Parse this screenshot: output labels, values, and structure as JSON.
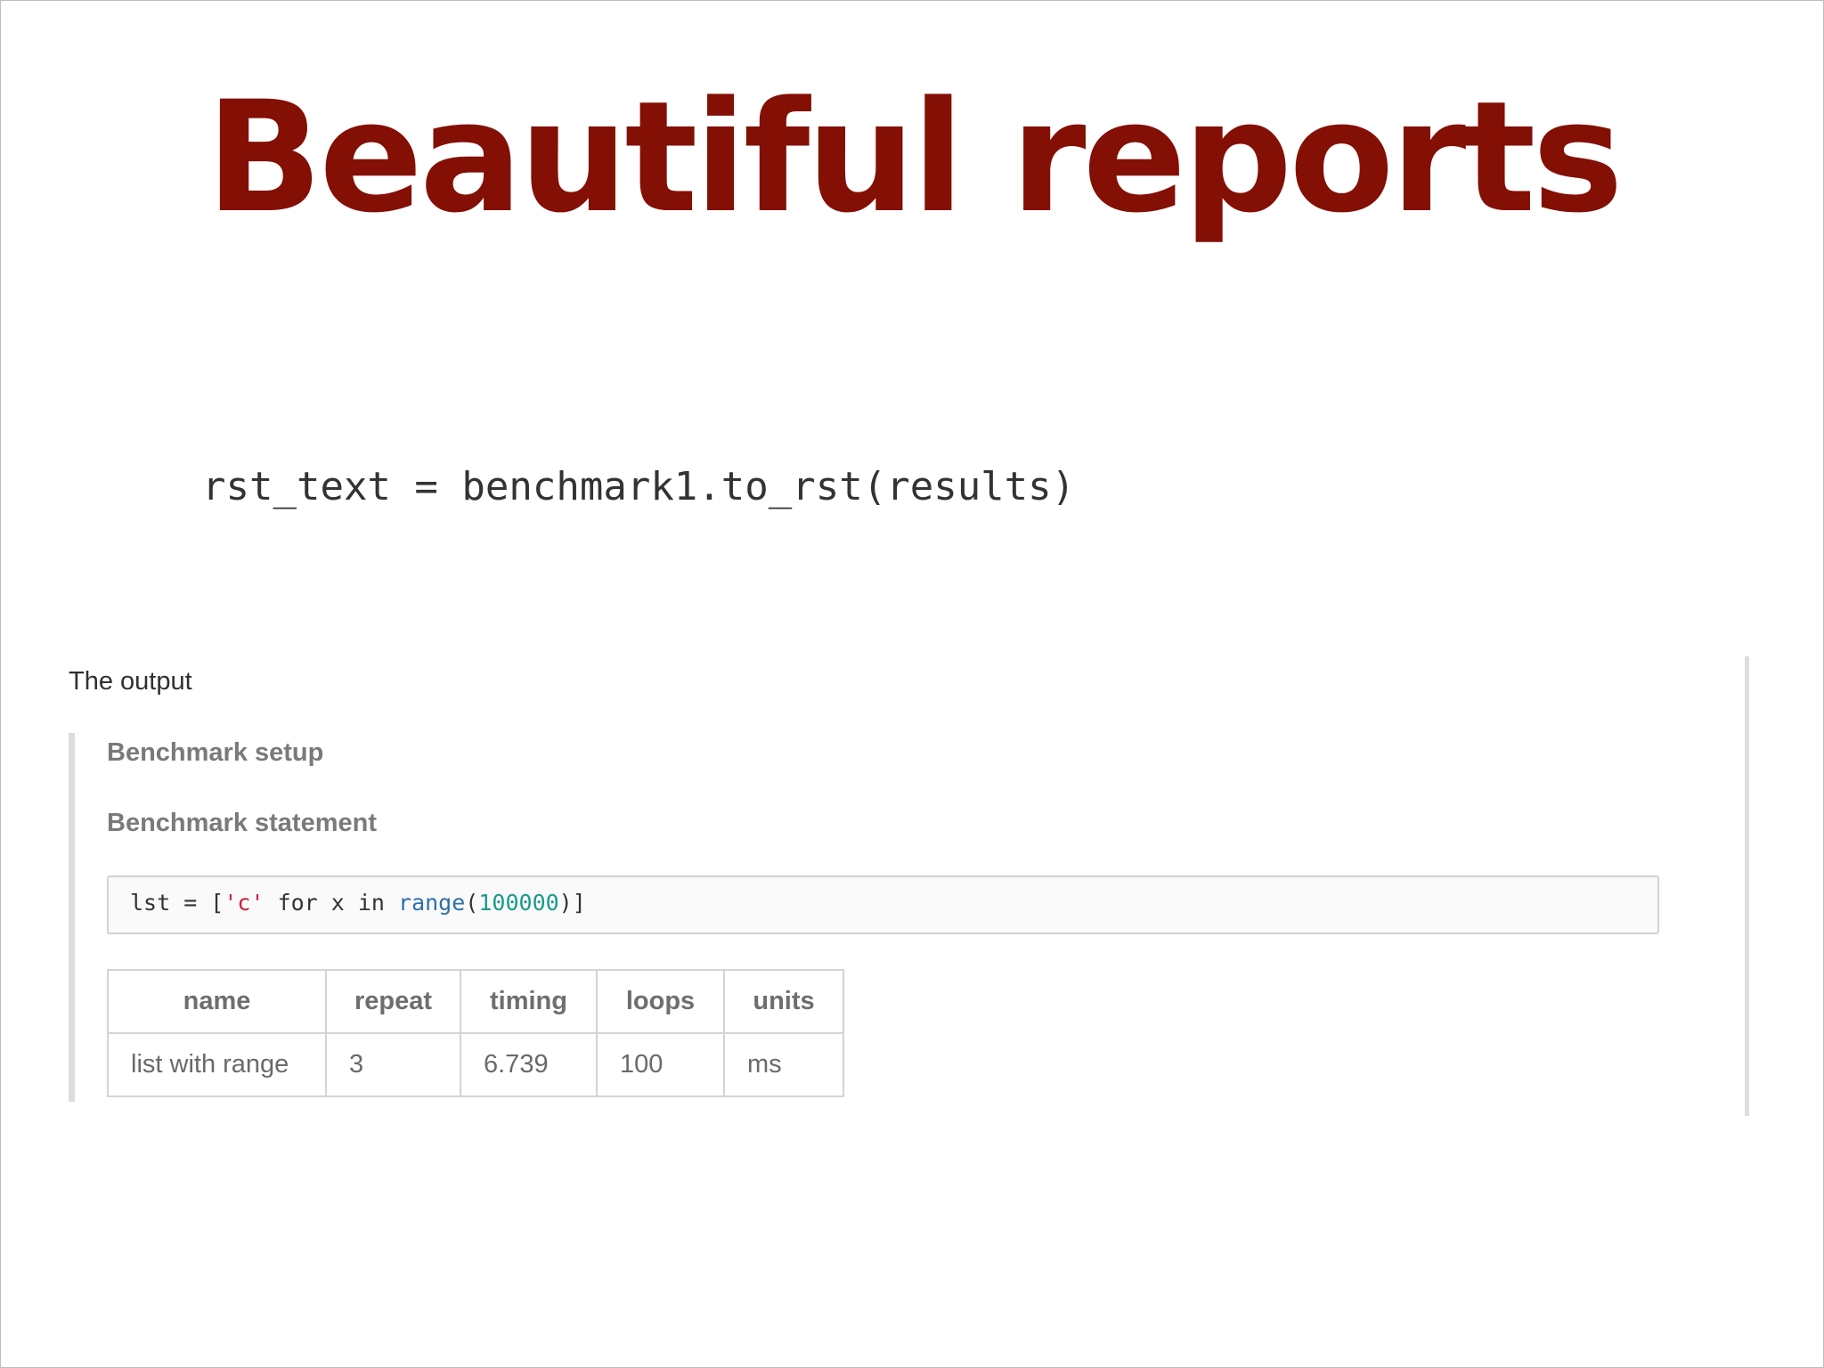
{
  "slide": {
    "title": "Beautiful reports",
    "code_line": "rst_text = benchmark1.to_rst(results)",
    "title_color": "#840f05"
  },
  "output": {
    "label": "The output",
    "section_setup": "Benchmark setup",
    "section_statement": "Benchmark statement",
    "statement_code": {
      "t1": "lst = [",
      "t2": "'c'",
      "t3": " for x in ",
      "t4": "range",
      "t5": "(",
      "t6": "100000",
      "t7": ")]"
    },
    "table": {
      "headers": [
        "name",
        "repeat",
        "timing",
        "loops",
        "units"
      ],
      "rows": [
        [
          "list with range",
          "3",
          "6.739",
          "100",
          "ms"
        ]
      ]
    }
  }
}
